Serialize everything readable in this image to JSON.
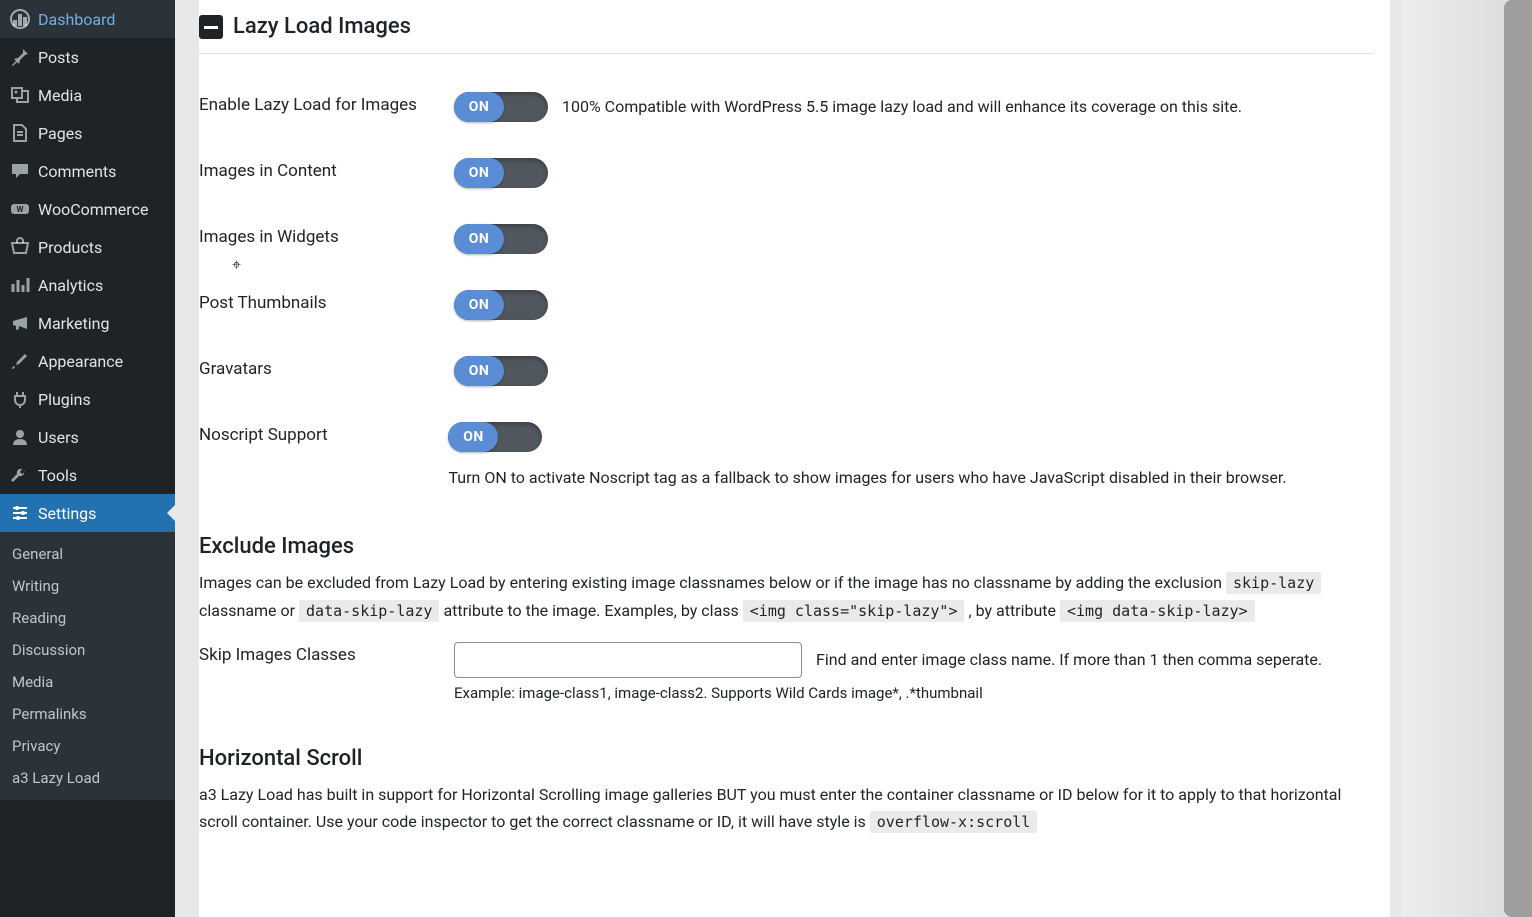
{
  "sidebar": {
    "items": [
      {
        "label": "Dashboard"
      },
      {
        "label": "Posts"
      },
      {
        "label": "Media"
      },
      {
        "label": "Pages"
      },
      {
        "label": "Comments"
      },
      {
        "label": "WooCommerce"
      },
      {
        "label": "Products"
      },
      {
        "label": "Analytics"
      },
      {
        "label": "Marketing"
      },
      {
        "label": "Appearance"
      },
      {
        "label": "Plugins"
      },
      {
        "label": "Users"
      },
      {
        "label": "Tools"
      },
      {
        "label": "Settings"
      }
    ],
    "submenu": [
      "General",
      "Writing",
      "Reading",
      "Discussion",
      "Media",
      "Permalinks",
      "Privacy",
      "a3 Lazy Load"
    ]
  },
  "section": {
    "title": "Lazy Load Images",
    "toggles": [
      {
        "label": "Enable Lazy Load for Images",
        "state": "ON",
        "desc": "100% Compatible with WordPress 5.5 image lazy load and will enhance its coverage on this site."
      },
      {
        "label": "Images in Content",
        "state": "ON",
        "desc": ""
      },
      {
        "label": "Images in Widgets",
        "state": "ON",
        "desc": ""
      },
      {
        "label": "Post Thumbnails",
        "state": "ON",
        "desc": ""
      },
      {
        "label": "Gravatars",
        "state": "ON",
        "desc": ""
      },
      {
        "label": "Noscript Support",
        "state": "ON",
        "desc": "Turn ON to activate Noscript tag as a fallback to show images for users who have JavaScript disabled in their browser."
      }
    ],
    "exclude": {
      "title": "Exclude Images",
      "p_a": "Images can be excluded from Lazy Load by entering existing image classnames below or if the image has no classname by adding the exclusion ",
      "code1": "skip-lazy",
      "p_b": " classname or ",
      "code2": "data-skip-lazy",
      "p_c": " attribute to the image. Examples, by class ",
      "code3": "<img class=\"skip-lazy\">",
      "p_d": " , by attribute ",
      "code4": "<img data-skip-lazy>",
      "skip_label": "Skip Images Classes",
      "skip_desc": "Find and enter image class name. If more than 1 then comma seperate.",
      "skip_example": "Example: image-class1, image-class2. Supports Wild Cards image*, .*thumbnail"
    },
    "hscroll": {
      "title": "Horizontal Scroll",
      "p_a": "a3 Lazy Load has built in support for Horizontal Scrolling image galleries BUT you must enter the container classname or ID below for it to apply to that horizontal scroll container. Use your code inspector to get the correct classname or ID, it will have style is ",
      "code": "overflow-x:scroll"
    }
  }
}
